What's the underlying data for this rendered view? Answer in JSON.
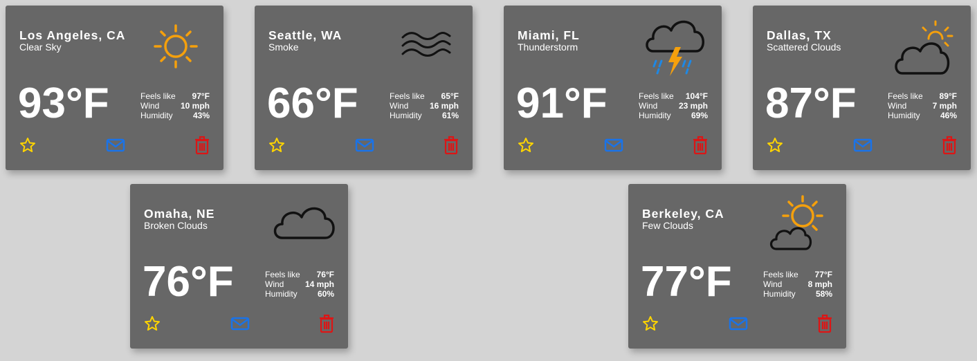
{
  "colors": {
    "page_background": "#d4d4d4",
    "card_background": "#676767",
    "text": "#ffffff",
    "star": "#ffd500",
    "mail": "#1a73e8",
    "trash": "#dd1515",
    "sun": "#f5a00c",
    "rain": "#1e88e5",
    "outline": "#111111"
  },
  "stat_labels": {
    "feels_like": "Feels like",
    "wind": "Wind",
    "humidity": "Humidity"
  },
  "cards": [
    {
      "city": "Los Angeles, CA",
      "condition": "Clear Sky",
      "temperature": "93°F",
      "feels_like": "97°F",
      "wind": "10 mph",
      "humidity": "43%",
      "icon": "clear-sky-icon"
    },
    {
      "city": "Seattle, WA",
      "condition": "Smoke",
      "temperature": "66°F",
      "feels_like": "65°F",
      "wind": "16 mph",
      "humidity": "61%",
      "icon": "smoke-icon"
    },
    {
      "city": "Miami, FL",
      "condition": "Thunderstorm",
      "temperature": "91°F",
      "feels_like": "104°F",
      "wind": "23 mph",
      "humidity": "69%",
      "icon": "thunderstorm-icon"
    },
    {
      "city": "Dallas, TX",
      "condition": "Scattered Clouds",
      "temperature": "87°F",
      "feels_like": "89°F",
      "wind": "7 mph",
      "humidity": "46%",
      "icon": "scattered-clouds-icon"
    },
    {
      "city": "Omaha, NE",
      "condition": "Broken Clouds",
      "temperature": "76°F",
      "feels_like": "76°F",
      "wind": "14 mph",
      "humidity": "60%",
      "icon": "broken-clouds-icon"
    },
    {
      "city": "Berkeley, CA",
      "condition": "Few Clouds",
      "temperature": "77°F",
      "feels_like": "77°F",
      "wind": "8 mph",
      "humidity": "58%",
      "icon": "few-clouds-icon"
    }
  ]
}
